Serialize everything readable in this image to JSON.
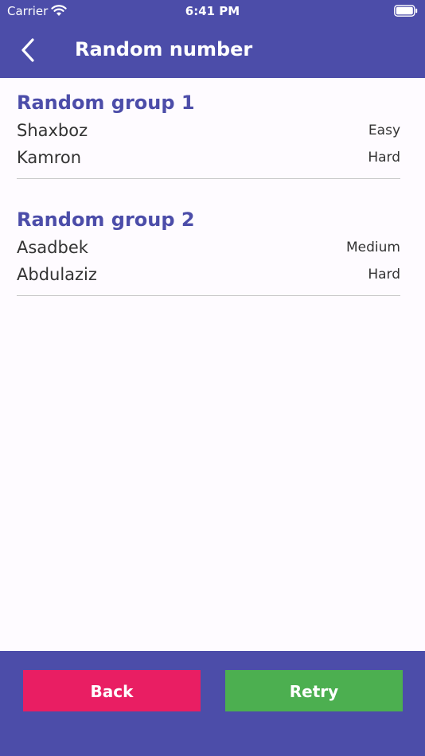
{
  "status_bar": {
    "carrier": "Carrier",
    "time": "6:41 PM",
    "icons": [
      "wifi-icon",
      "battery-icon"
    ]
  },
  "nav": {
    "title": "Random number",
    "back_icon": "chevron-left-icon"
  },
  "groups": [
    {
      "title": "Random group 1",
      "members": [
        {
          "name": "Shaxboz",
          "level": "Easy"
        },
        {
          "name": "Kamron",
          "level": "Hard"
        }
      ]
    },
    {
      "title": "Random group 2",
      "members": [
        {
          "name": "Asadbek",
          "level": "Medium"
        },
        {
          "name": "Abdulaziz",
          "level": "Hard"
        }
      ]
    }
  ],
  "footer": {
    "back_label": "Back",
    "retry_label": "Retry"
  },
  "colors": {
    "primary": "#4C4DA9",
    "back_button": "#E91E63",
    "retry_button": "#4CAF50",
    "background": "#FEFBFF"
  }
}
